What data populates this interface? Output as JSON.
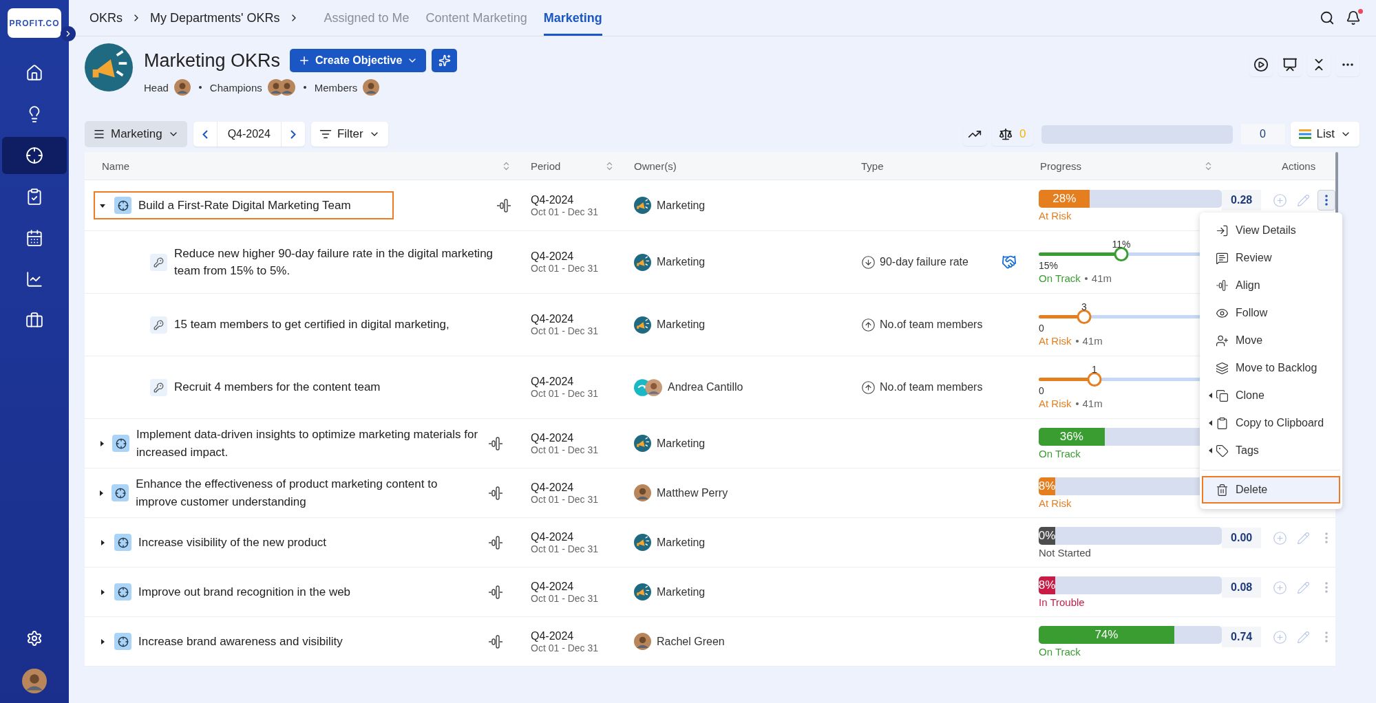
{
  "sidebar": {
    "logo": "PROFIT.CO",
    "items": [
      {
        "selected": false
      },
      {
        "selected": false
      },
      {
        "selected": true
      },
      {
        "selected": false
      },
      {
        "selected": false
      },
      {
        "selected": false
      },
      {
        "selected": false
      }
    ]
  },
  "breadcrumbs": [
    "OKRs",
    "My Departments' OKRs"
  ],
  "tabs": [
    {
      "label": "Assigned to Me",
      "selected": false
    },
    {
      "label": "Content Marketing",
      "selected": false
    },
    {
      "label": "Marketing",
      "selected": true
    }
  ],
  "notifications": {
    "unread": true
  },
  "header": {
    "title": "Marketing OKRs",
    "create_button": "Create Objective",
    "people": [
      {
        "label": "Head",
        "avatars": [
          {
            "kind": "person"
          }
        ]
      },
      {
        "label": "Champions",
        "avatars": [
          {
            "kind": "person"
          },
          {
            "kind": "person"
          }
        ]
      },
      {
        "label": "Members",
        "avatars": [
          {
            "kind": "person"
          }
        ]
      }
    ]
  },
  "toolbar": {
    "group": "Marketing",
    "period": "Q4-2024",
    "filter": "Filter",
    "balance_count": "0",
    "total": "0",
    "view": "List"
  },
  "table": {
    "columns": [
      "Name",
      "Period",
      "Owner(s)",
      "Type",
      "Progress",
      "Actions"
    ],
    "rows": [
      {
        "kind": "objective",
        "expanded": true,
        "highlighted": true,
        "name": "Build a First-Rate Digital Marketing Team",
        "period": "Q4-2024",
        "dates": "Oct 01 - Dec 31",
        "owner": {
          "name": "Marketing",
          "kind": "team"
        },
        "progress": {
          "kind": "bar",
          "label": "28%",
          "level": 0.28,
          "status": "At Risk",
          "color": "#e57e1f"
        },
        "actions": {
          "score": "0.28",
          "menu_open": true
        }
      },
      {
        "kind": "key_result",
        "highlighted": false,
        "name": "Reduce new higher 90-day failure rate in the digital marketing team from 15% to 5%.",
        "period": "Q4-2024",
        "dates": "Oct 01 - Dec 31",
        "owner": {
          "name": "Marketing",
          "kind": "team"
        },
        "type": {
          "kind": "decrease",
          "label": "90-day failure rate",
          "linked": true
        },
        "progress": {
          "kind": "slider",
          "value": "11%",
          "start": "15%",
          "level": 0.4,
          "status": "On Track",
          "updated": "41m",
          "color": "#3a9d32"
        }
      },
      {
        "kind": "key_result",
        "highlighted": false,
        "name": "15 team members to get certified in digital marketing,",
        "period": "Q4-2024",
        "dates": "Oct 01 - Dec 31",
        "owner": {
          "name": "Marketing",
          "kind": "team"
        },
        "type": {
          "kind": "increase",
          "label": "No.of team members",
          "linked": false
        },
        "progress": {
          "kind": "slider",
          "value": "3",
          "start": "0",
          "level": 0.22,
          "status": "At Risk",
          "updated": "41m",
          "color": "#e57e1f"
        }
      },
      {
        "kind": "key_result",
        "highlighted": false,
        "name": "Recruit 4 members for the content team",
        "period": "Q4-2024",
        "dates": "Oct 01 - Dec 31",
        "owner": {
          "name": "Andrea Cantillo",
          "kind": "team_person"
        },
        "type": {
          "kind": "increase",
          "label": "No.of team members",
          "linked": false
        },
        "progress": {
          "kind": "slider",
          "value": "1",
          "start": "0",
          "level": 0.27,
          "status": "At Risk",
          "updated": "41m",
          "color": "#e57e1f"
        }
      },
      {
        "kind": "objective",
        "expanded": false,
        "highlighted": false,
        "name": "Implement data-driven insights to optimize marketing materials for increased impact.",
        "period": "Q4-2024",
        "dates": "Oct 01 - Dec 31",
        "owner": {
          "name": "Marketing",
          "kind": "team"
        },
        "progress": {
          "kind": "bar",
          "label": "36%",
          "level": 0.36,
          "status": "On Track",
          "color": "#3a9d32"
        }
      },
      {
        "kind": "objective",
        "expanded": false,
        "highlighted": false,
        "name": "Enhance the effectiveness of product marketing content to improve customer understanding",
        "period": "Q4-2024",
        "dates": "Oct 01 - Dec 31",
        "owner": {
          "name": "Matthew Perry",
          "kind": "person"
        },
        "progress": {
          "kind": "bar",
          "label": "8%",
          "level": 0.08,
          "status": "At Risk",
          "color": "#e57e1f"
        }
      },
      {
        "kind": "objective",
        "expanded": false,
        "highlighted": false,
        "name": "Increase visibility of the new product",
        "period": "Q4-2024",
        "dates": "Oct 01 - Dec 31",
        "owner": {
          "name": "Marketing",
          "kind": "team"
        },
        "progress": {
          "kind": "bar",
          "label": "0%",
          "level": 0,
          "status": "Not Started",
          "color": "#4d4d4d"
        },
        "actions": {
          "score": "0.00",
          "menu_open": false
        }
      },
      {
        "kind": "objective",
        "expanded": false,
        "highlighted": false,
        "name": "Improve out brand recognition in the web",
        "period": "Q4-2024",
        "dates": "Oct 01 - Dec 31",
        "owner": {
          "name": "Marketing",
          "kind": "team"
        },
        "progress": {
          "kind": "bar",
          "label": "8%",
          "level": 0.08,
          "status": "In Trouble",
          "color": "#c81b45"
        },
        "actions": {
          "score": "0.08",
          "menu_open": false
        }
      },
      {
        "kind": "objective",
        "expanded": false,
        "highlighted": false,
        "name": "Increase brand awareness and visibility",
        "period": "Q4-2024",
        "dates": "Oct 01 - Dec 31",
        "owner": {
          "name": "Rachel Green",
          "kind": "person"
        },
        "progress": {
          "kind": "bar",
          "label": "74%",
          "level": 0.74,
          "status": "On Track",
          "color": "#3a9d32"
        },
        "actions": {
          "score": "0.74",
          "menu_open": false
        }
      }
    ]
  },
  "menu": {
    "groups": [
      {
        "items": [
          {
            "label": "View Details",
            "submenu": false,
            "highlighted": false
          },
          {
            "label": "Review",
            "submenu": false,
            "highlighted": false
          },
          {
            "label": "Align",
            "submenu": false,
            "highlighted": false
          },
          {
            "label": "Follow",
            "submenu": false,
            "highlighted": false
          },
          {
            "label": "Move",
            "submenu": false,
            "highlighted": false
          },
          {
            "label": "Move to Backlog",
            "submenu": false,
            "highlighted": false
          },
          {
            "label": "Clone",
            "submenu": true,
            "highlighted": false
          },
          {
            "label": "Copy to Clipboard",
            "submenu": true,
            "highlighted": false
          },
          {
            "label": "Tags",
            "submenu": true,
            "highlighted": false
          }
        ]
      },
      {
        "items": [
          {
            "label": "Delete",
            "submenu": false,
            "highlighted": true
          }
        ]
      }
    ]
  }
}
